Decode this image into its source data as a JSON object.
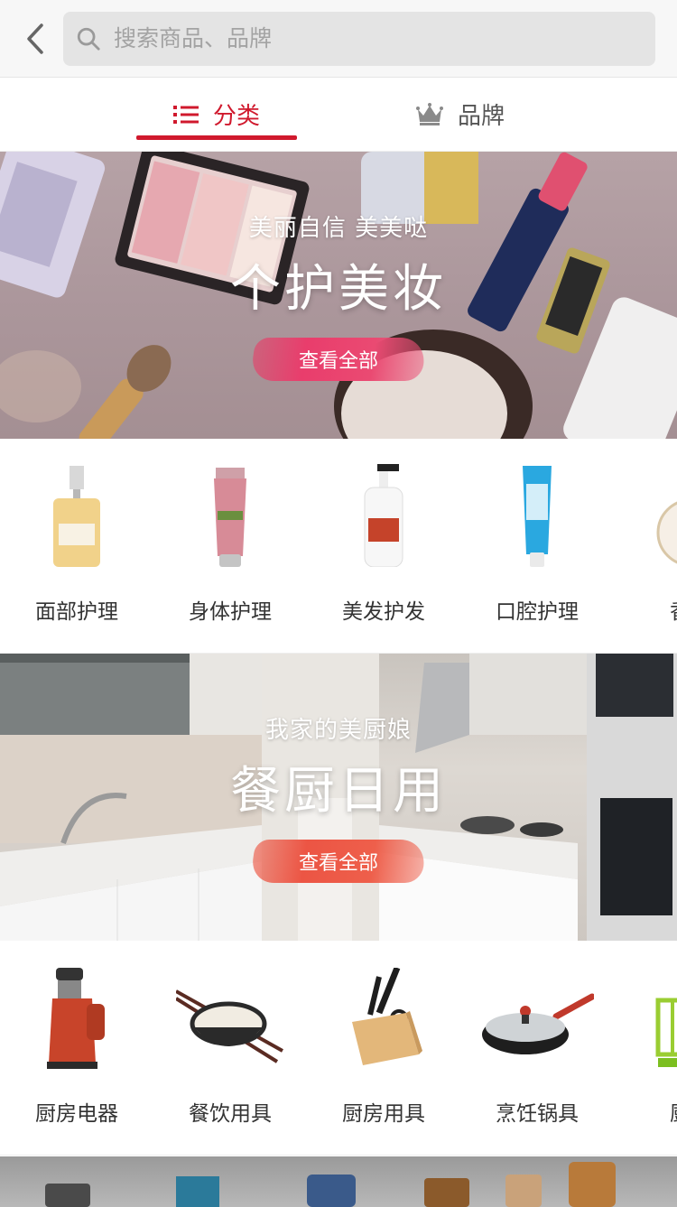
{
  "header": {
    "search_placeholder": "搜索商品、品牌"
  },
  "tabs": [
    {
      "label": "分类",
      "active": true
    },
    {
      "label": "品牌",
      "active": false
    }
  ],
  "sections": [
    {
      "banner": {
        "subtitle": "美丽自信 美美哒",
        "title": "个护美妆",
        "button": "查看全部"
      },
      "items": [
        "面部护理",
        "身体护理",
        "美发护发",
        "口腔护理",
        "香水"
      ]
    },
    {
      "banner": {
        "subtitle": "我家的美厨娘",
        "title": "餐厨日用",
        "button": "查看全部"
      },
      "items": [
        "厨房电器",
        "餐饮用具",
        "厨房用具",
        "烹饪锅具",
        "厨房"
      ]
    }
  ],
  "colors": {
    "accent": "#d0192d",
    "beauty_button": "#e93d6c",
    "kitchen_button": "#ec5544"
  }
}
